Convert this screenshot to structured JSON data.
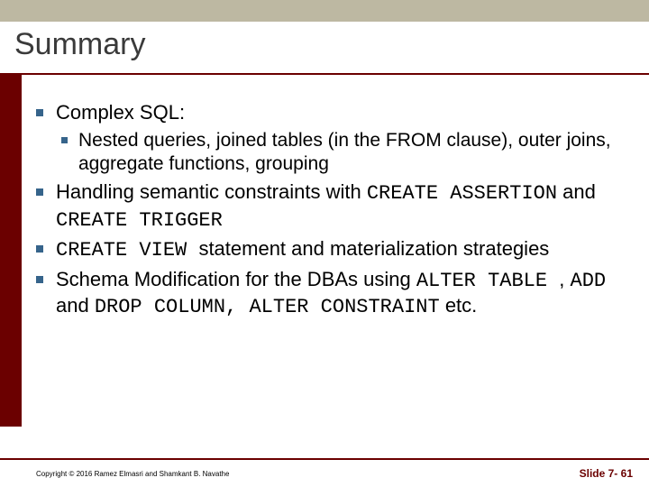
{
  "title": "Summary",
  "bullets": {
    "b1": {
      "text": "Complex SQL:",
      "sub": "Nested queries, joined tables (in the FROM clause), outer joins, aggregate functions, grouping"
    },
    "b2": {
      "pre": "Handling semantic constraints with ",
      "code1": "CREATE ASSERTION",
      "mid": " and ",
      "code2": "CREATE TRIGGER"
    },
    "b3": {
      "code": "CREATE VIEW ",
      "post": " statement and materialization strategies"
    },
    "b4": {
      "pre": "Schema Modification for the DBAs using ",
      "code1": "ALTER TABLE ",
      "mid1": ", ",
      "code2": "ADD",
      "mid2": " and ",
      "code3": "DROP COLUMN, ALTER CONSTRAINT",
      "post": " etc."
    }
  },
  "footer": {
    "copyright": "Copyright © 2016 Ramez Elmasri and Shamkant B. Navathe",
    "slide": "Slide 7- 61"
  }
}
